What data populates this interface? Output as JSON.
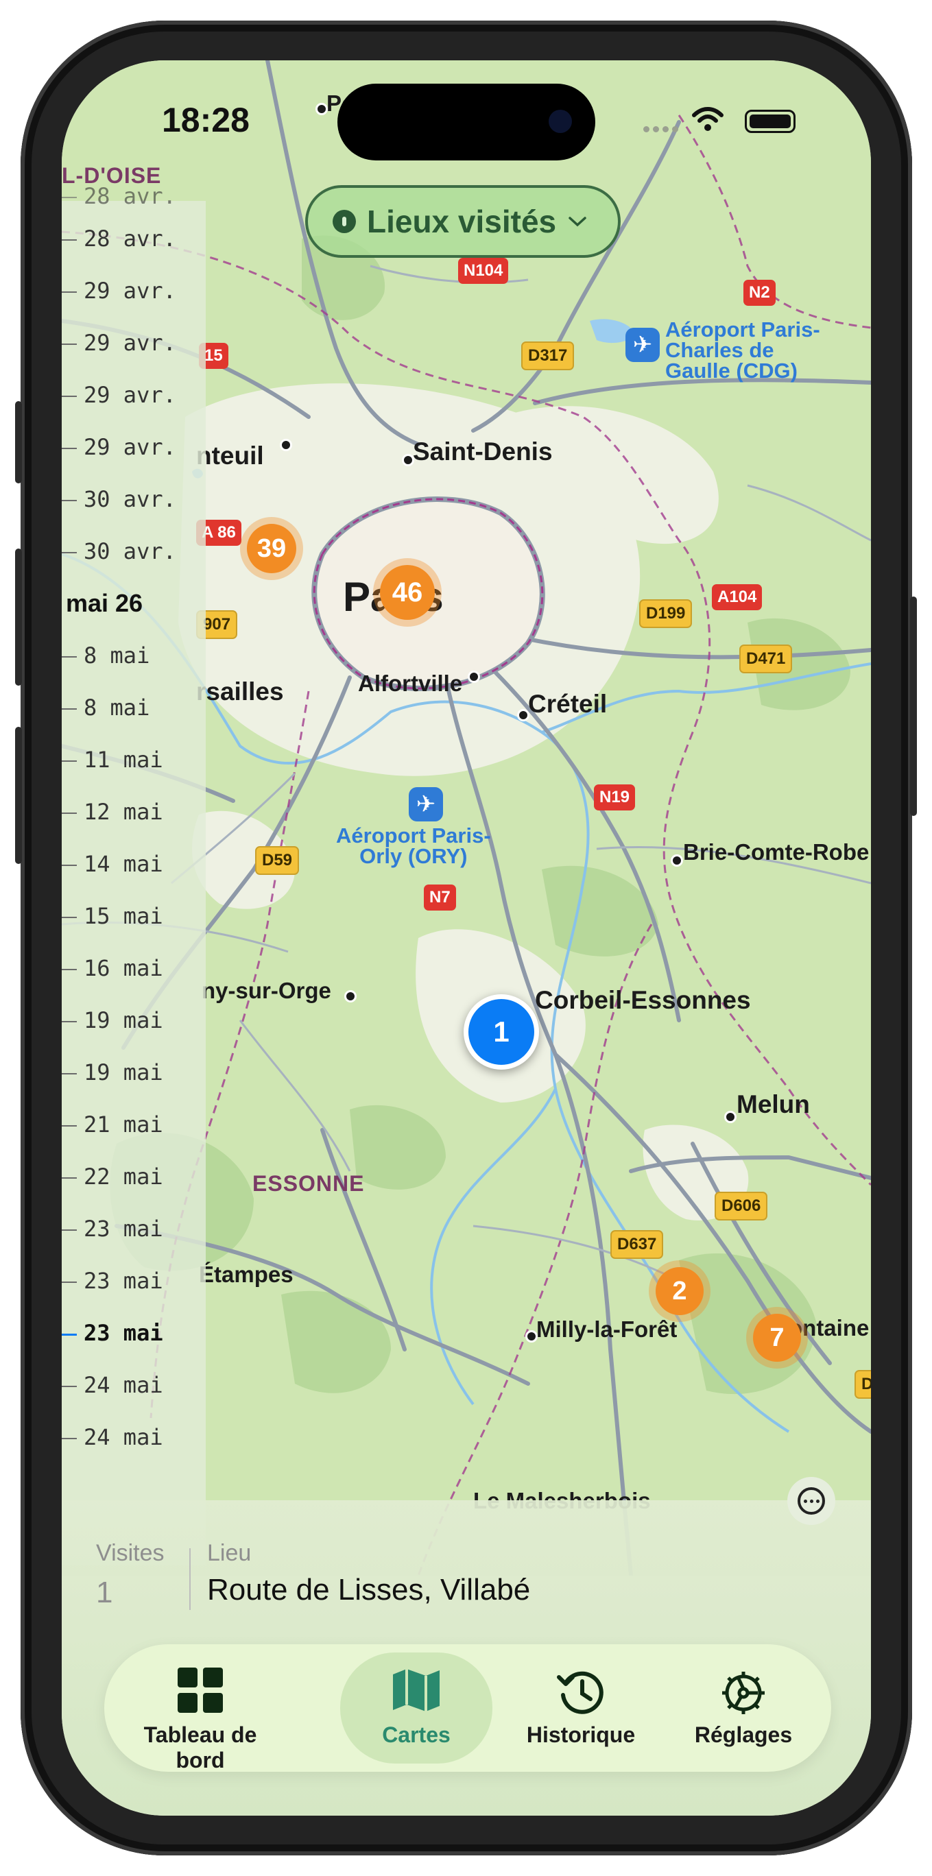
{
  "status_bar": {
    "time": "18:28"
  },
  "filter": {
    "label": "Lieux visités"
  },
  "map": {
    "places": {
      "val_doise": "L-D'OISE",
      "pe": "Pe",
      "saint_denis": "Saint-Denis",
      "enteuil": "nteuil",
      "paris": "Paris",
      "versailles": "rsailles",
      "alfortville": "Alfortville",
      "creteil": "Créteil",
      "brie": "Brie-Comte-Robe",
      "savigny": "ny-sur-Orge",
      "corbeil": "Corbeil-Essonnes",
      "melun": "Melun",
      "essonne": "ESSONNE",
      "etampes": "Étampes",
      "milly": "Milly-la-Forêt",
      "fontaine": "ontaine",
      "malesherbois": "Le Malesherbois",
      "cdg_airport": "Aéroport Paris-\nCharles de\nGaulle (CDG)",
      "orly_airport": "Aéroport Paris-\nOrly (ORY)"
    },
    "road_shields": {
      "n104": "N104",
      "n2": "N2",
      "d317": "D317",
      "a15": "15",
      "a86": "A 86",
      "d907": "907",
      "d199": "D199",
      "a104": "A104",
      "d471": "D471",
      "n19": "N19",
      "d59": "D59",
      "n7": "N7",
      "d606": "D606",
      "d637": "D637",
      "d_edge": "D"
    },
    "clusters": {
      "c39": "39",
      "c46": "46",
      "c2": "2",
      "c7": "7",
      "selected": "1"
    }
  },
  "timeline": {
    "items": [
      {
        "label": "28 avr."
      },
      {
        "label": "29 avr."
      },
      {
        "label": "29 avr."
      },
      {
        "label": "29 avr."
      },
      {
        "label": "29 avr."
      },
      {
        "label": "30 avr."
      },
      {
        "label": "30 avr."
      },
      {
        "label": "8 mai"
      },
      {
        "label": "8 mai"
      },
      {
        "label": "11 mai"
      },
      {
        "label": "12 mai"
      },
      {
        "label": "14 mai"
      },
      {
        "label": "15 mai"
      },
      {
        "label": "16 mai"
      },
      {
        "label": "19 mai"
      },
      {
        "label": "19 mai"
      },
      {
        "label": "21 mai"
      },
      {
        "label": "22 mai"
      },
      {
        "label": "23 mai"
      },
      {
        "label": "23 mai"
      },
      {
        "label": "23 mai",
        "selected": true
      },
      {
        "label": "24 mai"
      },
      {
        "label": "24 mai"
      }
    ],
    "month_header": "mai 26",
    "top_partial": "28 avr."
  },
  "info": {
    "visits_header": "Visites",
    "visits_value": "1",
    "place_header": "Lieu",
    "place_value": "Route de Lisses, Villabé"
  },
  "tabs": [
    {
      "label": "Tableau de bord",
      "icon": "grid-icon"
    },
    {
      "label": "Cartes",
      "icon": "map-icon",
      "active": true
    },
    {
      "label": "Historique",
      "icon": "history-icon"
    },
    {
      "label": "Réglages",
      "icon": "gear-icon"
    }
  ],
  "colors": {
    "accent": "#2a8a6e",
    "pin_blue": "#0a7cf5",
    "cluster_orange": "#f28c24"
  }
}
